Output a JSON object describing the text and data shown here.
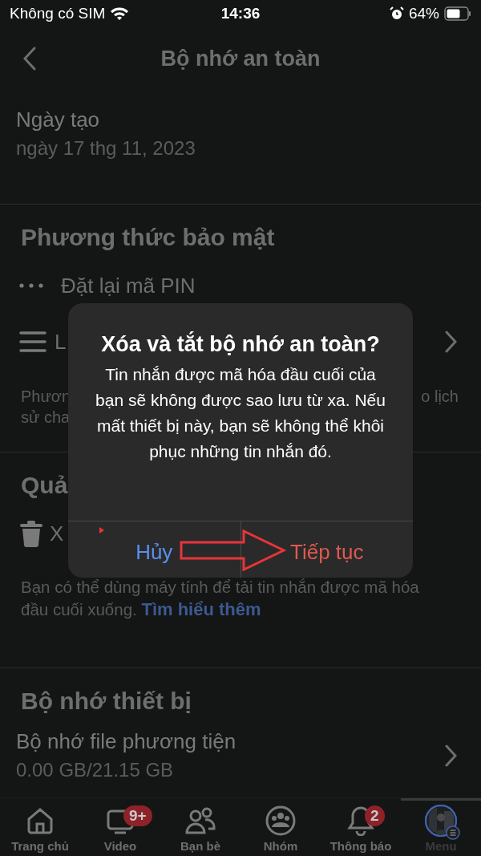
{
  "status_bar": {
    "carrier": "Không có SIM",
    "time": "14:36",
    "battery": "64%"
  },
  "header": {
    "title": "Bộ nhớ an toàn"
  },
  "created": {
    "label": "Ngày tạo",
    "value": "ngày 17 thg 11, 2023"
  },
  "security": {
    "heading": "Phương thức bảo mật",
    "rows": [
      {
        "kind": "dots",
        "label": "Đặt lại mã PIN",
        "chevron": false
      },
      {
        "kind": "list",
        "label": "L",
        "chevron": true
      }
    ],
    "description": {
      "left_1": "Phươn",
      "right_1": "o lịch",
      "left_2": "sử cha"
    }
  },
  "manage": {
    "heading": "Quả",
    "row_label": "X",
    "description": "Bạn có thể dùng máy tính để tải tin nhắn được mã hóa đầu cuối xuống.",
    "link": "Tìm hiểu thêm"
  },
  "device": {
    "heading": "Bộ nhớ thiết bị",
    "row_title": "Bộ nhớ file phương tiện",
    "row_value": "0.00 GB/21.15 GB"
  },
  "dialog": {
    "title": "Xóa và tắt bộ nhớ an toàn?",
    "message": "Tin nhắn được mã hóa đầu cuối của bạn sẽ không được sao lưu từ xa. Nếu mất thiết bị này, bạn sẽ không thể khôi phục những tin nhắn đó.",
    "buttons": [
      {
        "label": "Hủy",
        "kind": "cancel"
      },
      {
        "label": "Tiếp tục",
        "kind": "destructive"
      }
    ]
  },
  "tabs": [
    {
      "kind": "home",
      "label": "Trang chủ",
      "selected": false
    },
    {
      "kind": "video",
      "label": "Video",
      "badge": "9+",
      "selected": false
    },
    {
      "kind": "friends",
      "label": "Bạn bè",
      "selected": false
    },
    {
      "kind": "groups",
      "label": "Nhóm",
      "selected": false
    },
    {
      "kind": "bell",
      "label": "Thông báo",
      "badge": "2",
      "selected": false
    },
    {
      "kind": "menu",
      "label": "Menu",
      "selected": true
    }
  ]
}
